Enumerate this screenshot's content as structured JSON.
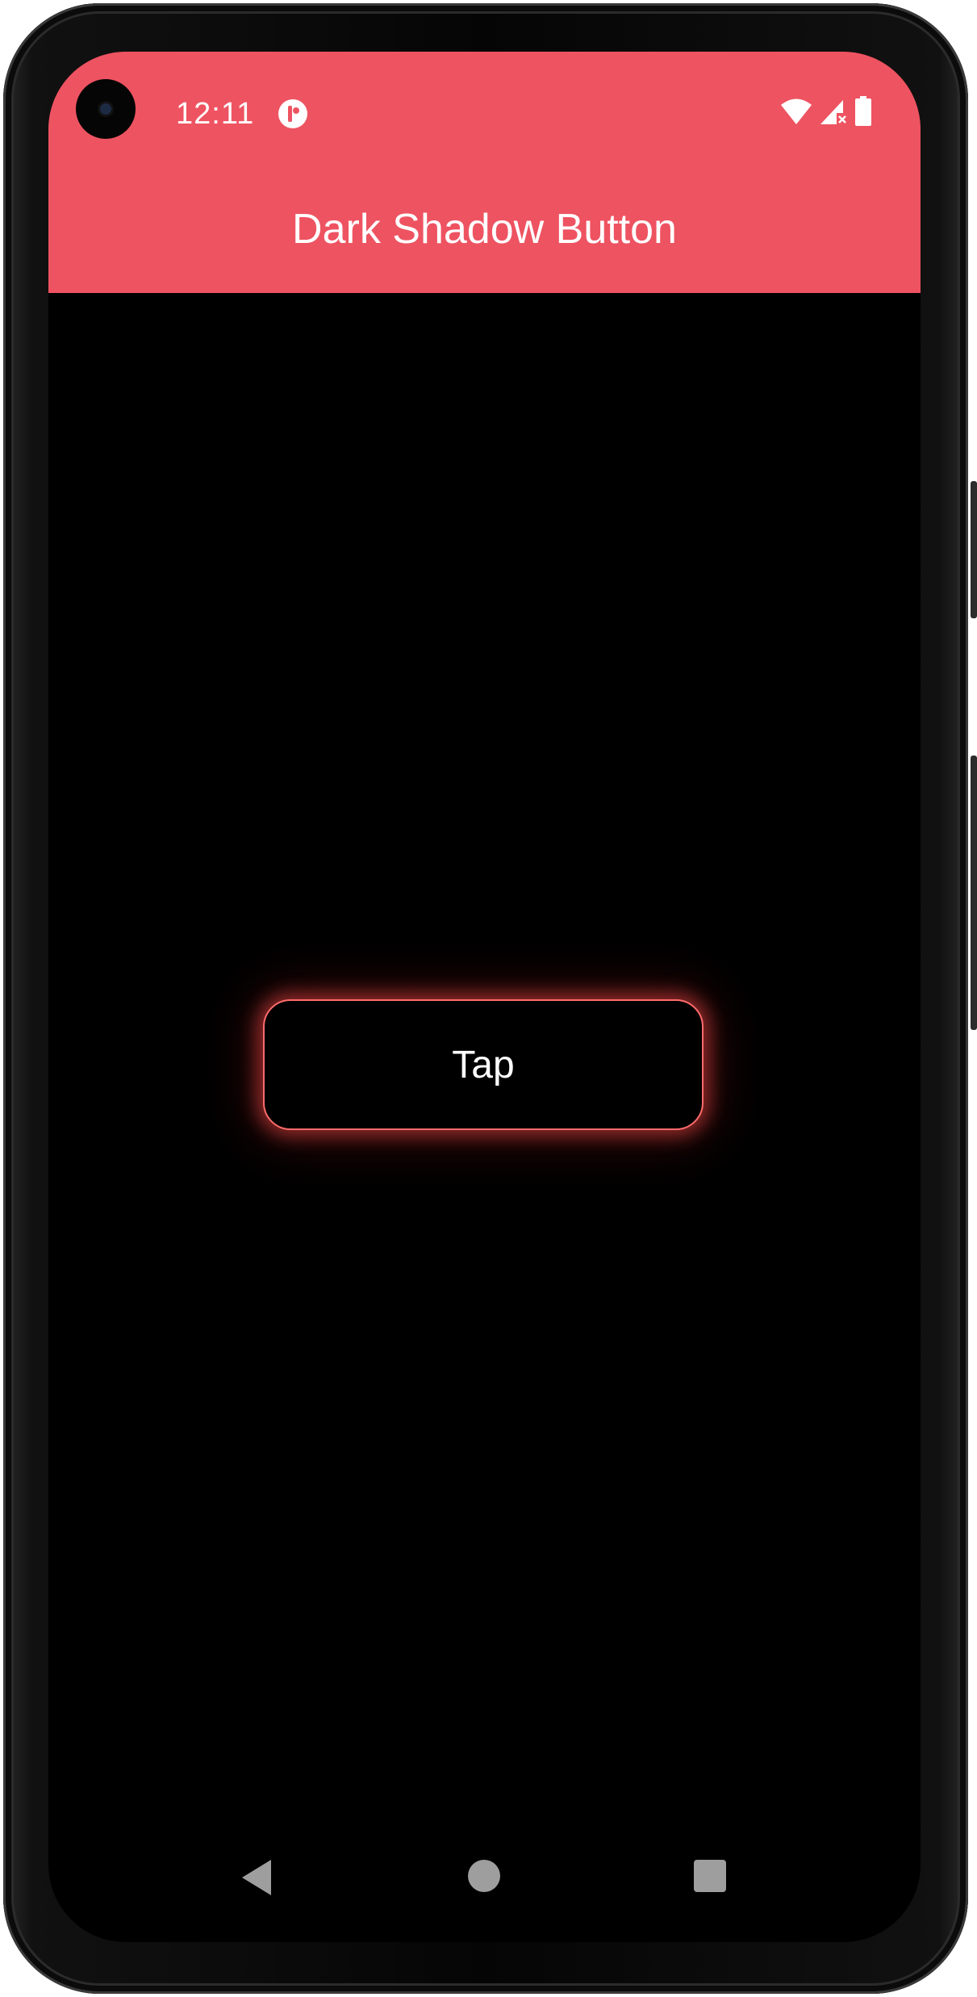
{
  "status_bar": {
    "time": "12:11",
    "icons": [
      "notification-app-icon",
      "wifi-icon",
      "signal-icon",
      "battery-icon"
    ]
  },
  "app_bar": {
    "title": "Dark Shadow Button",
    "background_color": "#EE5361"
  },
  "main": {
    "button_label": "Tap",
    "button_border_color": "#FF6B6B",
    "button_glow_color": "#EB4646",
    "background_color": "#000000"
  },
  "nav_bar": {
    "icons": [
      "back-icon",
      "home-icon",
      "recents-icon"
    ]
  }
}
